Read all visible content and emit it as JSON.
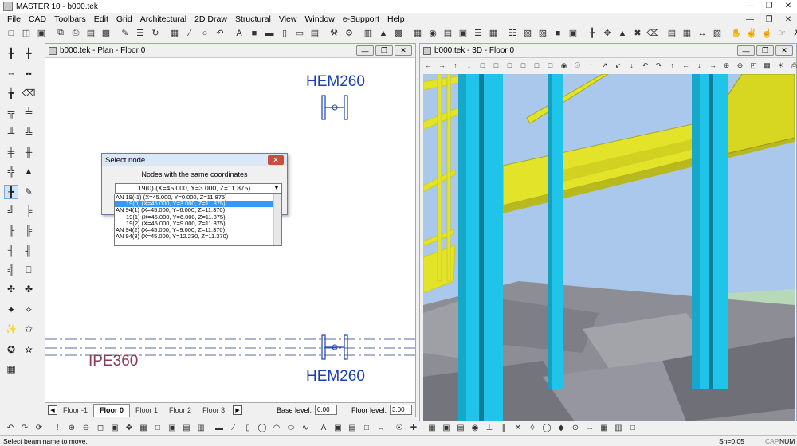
{
  "app": {
    "window_title": "MASTER 10 - b000.tek"
  },
  "menu": [
    "File",
    "CAD",
    "Toolbars",
    "Edit",
    "Grid",
    "Architectural",
    "2D Draw",
    "Structural",
    "View",
    "Window",
    "e-Support",
    "Help"
  ],
  "plan_window": {
    "title": "b000.tek - Plan - Floor 0",
    "labels": {
      "top_column": "HEM260",
      "bottom_column": "HEM260",
      "beam": "IPE360"
    },
    "floor_tabs": [
      "Floor -1",
      "Floor 0",
      "Floor 1",
      "Floor 2",
      "Floor 3"
    ],
    "active_floor": "Floor 0",
    "base_level_label": "Base level:",
    "base_level_value": "0.00",
    "floor_level_label": "Floor level:",
    "floor_level_value": "3.00"
  },
  "dialog": {
    "title": "Select node",
    "label": "Nodes with the same coordinates",
    "selected_value": "19(0) (X=45.000, Y=3.000, Z=11.875)",
    "options": [
      "AN 19(-1) (X=45.000, Y=0.000, Z=11.875)",
      "19(0) (X=45.000, Y=3.000, Z=11.875)",
      "AN 94(1) (X=45.000, Y=6.000, Z=11.370)",
      "19(1) (X=45.000, Y=6.000, Z=11.875)",
      "19(2) (X=45.000, Y=9.000, Z=11.875)",
      "AN 94(2) (X=45.000, Y=9.000, Z=11.370)",
      "AN 94(3) (X=45.000, Y=12.230, Z=11.370)"
    ],
    "selected_index": 1
  },
  "view3d_window": {
    "title": "b000.tek - 3D - Floor 0"
  },
  "statusbar": {
    "message": "Select beam name to move.",
    "snap": "Sn=0.05",
    "caps": "CAP",
    "num": "NUM"
  },
  "colors": {
    "column_cyan": "#1fc4e8",
    "beam_yellow": "#e3e32a",
    "sky": "#a9c8ec",
    "ground": "#8d8e95",
    "dialog_selection": "#3399ff",
    "plan_text": "#1a3fb5",
    "beam_label": "#8a3b55"
  }
}
